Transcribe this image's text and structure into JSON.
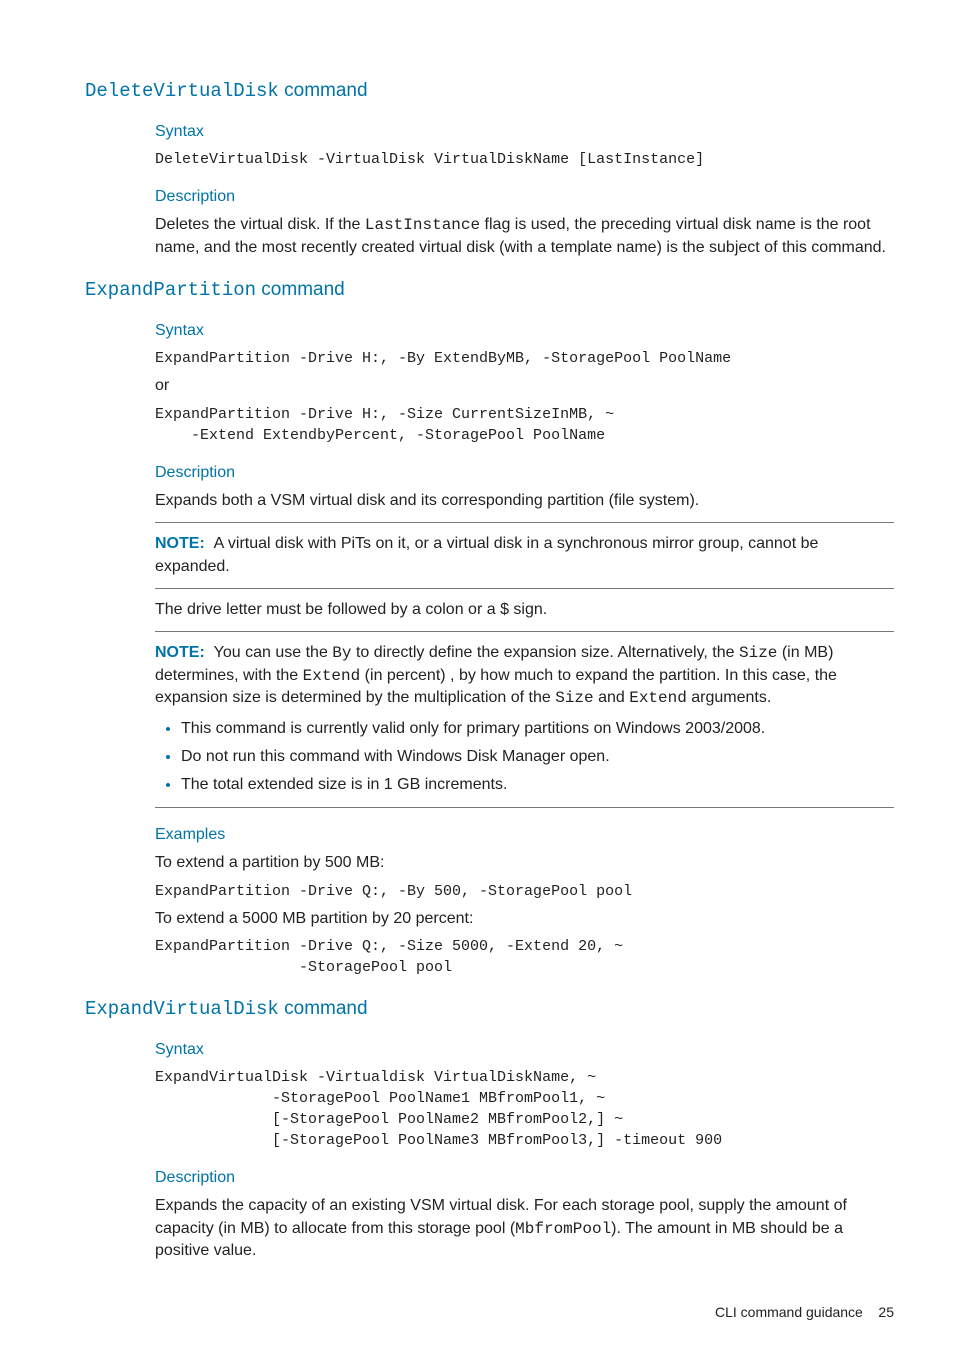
{
  "sections": [
    {
      "heading_mono": "DeleteVirtualDisk",
      "heading_tail": " command",
      "blocks": [
        {
          "h3": "Syntax"
        },
        {
          "code": "DeleteVirtualDisk -VirtualDisk VirtualDiskName [LastInstance]"
        },
        {
          "h3": "Description"
        },
        {
          "html": "Deletes the virtual disk. If the <span class=\"inline-mono\">LastInstance</span> flag is used, the preceding virtual disk name is the root name, and the most recently created virtual disk (with a template name) is the subject of this command."
        }
      ]
    },
    {
      "heading_mono": "ExpandPartition",
      "heading_tail": " command",
      "blocks": [
        {
          "h3": "Syntax"
        },
        {
          "code": "ExpandPartition -Drive H:, -By ExtendByMB, -StoragePool PoolName"
        },
        {
          "p": "or"
        },
        {
          "code": "ExpandPartition -Drive H:, -Size CurrentSizeInMB, ~\n    -Extend ExtendbyPercent, -StoragePool PoolName"
        },
        {
          "h3": "Description"
        },
        {
          "p": "Expands both a VSM virtual disk and its corresponding partition (file system)."
        },
        {
          "hr": true
        },
        {
          "html": "<span class=\"note-label\">NOTE:</span> &nbsp;A virtual disk with PiTs on it, or a virtual disk in a synchronous mirror group, cannot be expanded."
        },
        {
          "hr": true
        },
        {
          "p": "The drive letter must be followed by a colon or a $ sign."
        },
        {
          "hr": true
        },
        {
          "html": "<span class=\"note-label\">NOTE:</span> &nbsp;You can use the <span class=\"inline-mono\">By</span> to directly define the expansion size. Alternatively, the <span class=\"inline-mono\">Size</span> (in MB) determines, with the <span class=\"inline-mono\">Extend</span> (in percent) , by how much to expand the partition. In this case, the expansion size is determined by the multiplication of the <span class=\"inline-mono\">Size</span> and <span class=\"inline-mono\">Extend</span> arguments."
        },
        {
          "ul": [
            "This command is currently valid only for primary partitions on Windows 2003/2008.",
            "Do not run this command with Windows Disk Manager open.",
            "The total extended size is in 1 GB increments."
          ]
        },
        {
          "hr": true
        },
        {
          "h3": "Examples"
        },
        {
          "p": "To extend a partition by 500 MB:"
        },
        {
          "code": "ExpandPartition -Drive Q:, -By 500, -StoragePool pool"
        },
        {
          "p": "To extend a 5000 MB partition by 20 percent:"
        },
        {
          "code": "ExpandPartition -Drive Q:, -Size 5000, -Extend 20, ~\n                -StoragePool pool"
        }
      ]
    },
    {
      "heading_mono": "ExpandVirtualDisk",
      "heading_tail": " command",
      "blocks": [
        {
          "h3": "Syntax"
        },
        {
          "code": "ExpandVirtualDisk -Virtualdisk VirtualDiskName, ~\n             -StoragePool PoolName1 MBfromPool1, ~\n             [-StoragePool PoolName2 MBfromPool2,] ~\n             [-StoragePool PoolName3 MBfromPool3,] -timeout 900"
        },
        {
          "h3": "Description"
        },
        {
          "html": "Expands the capacity of an existing VSM virtual disk. For each storage pool, supply the amount of capacity (in MB) to allocate from this storage pool (<span class=\"inline-mono\">MbfromPool</span>). The amount in MB should be a positive value."
        }
      ]
    }
  ],
  "footer": {
    "text": "CLI command guidance",
    "page": "25"
  }
}
